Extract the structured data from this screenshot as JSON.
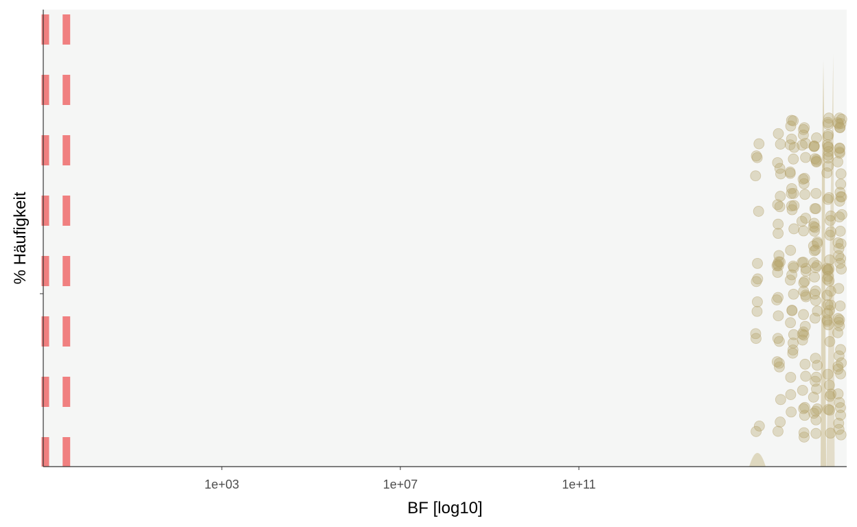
{
  "colors": {
    "panel_background": "#f5f6f5",
    "axis_line": "#333333",
    "reference_line": "#f08080",
    "points": "#b5a26b",
    "density": "#c8b98a"
  },
  "chart_data": {
    "type": "scatter",
    "title": "",
    "xlabel": "BF [log10]",
    "ylabel": "% Häufigkeit",
    "x_scale": "log10",
    "xlim": [
      0.1,
      1e+17
    ],
    "x_ticks": [
      {
        "value": 1000.0,
        "label": "1e+03"
      },
      {
        "value": 10000000.0,
        "label": "1e+07"
      },
      {
        "value": 100000000000.0,
        "label": "1e+11"
      }
    ],
    "y_ticks": [],
    "grid": false,
    "legend": "none",
    "reference_lines": [
      {
        "orientation": "vertical",
        "x": 0.1,
        "style": "dashed"
      },
      {
        "orientation": "vertical",
        "x": 0.33,
        "style": "dashed"
      }
    ],
    "point_columns_x": [
      1000000000000000.0,
      3000000000000000.0,
      6000000000000000.0,
      1.1e+16,
      2e+16,
      4e+16,
      7e+16
    ],
    "density_peak_x": 3e+16
  }
}
